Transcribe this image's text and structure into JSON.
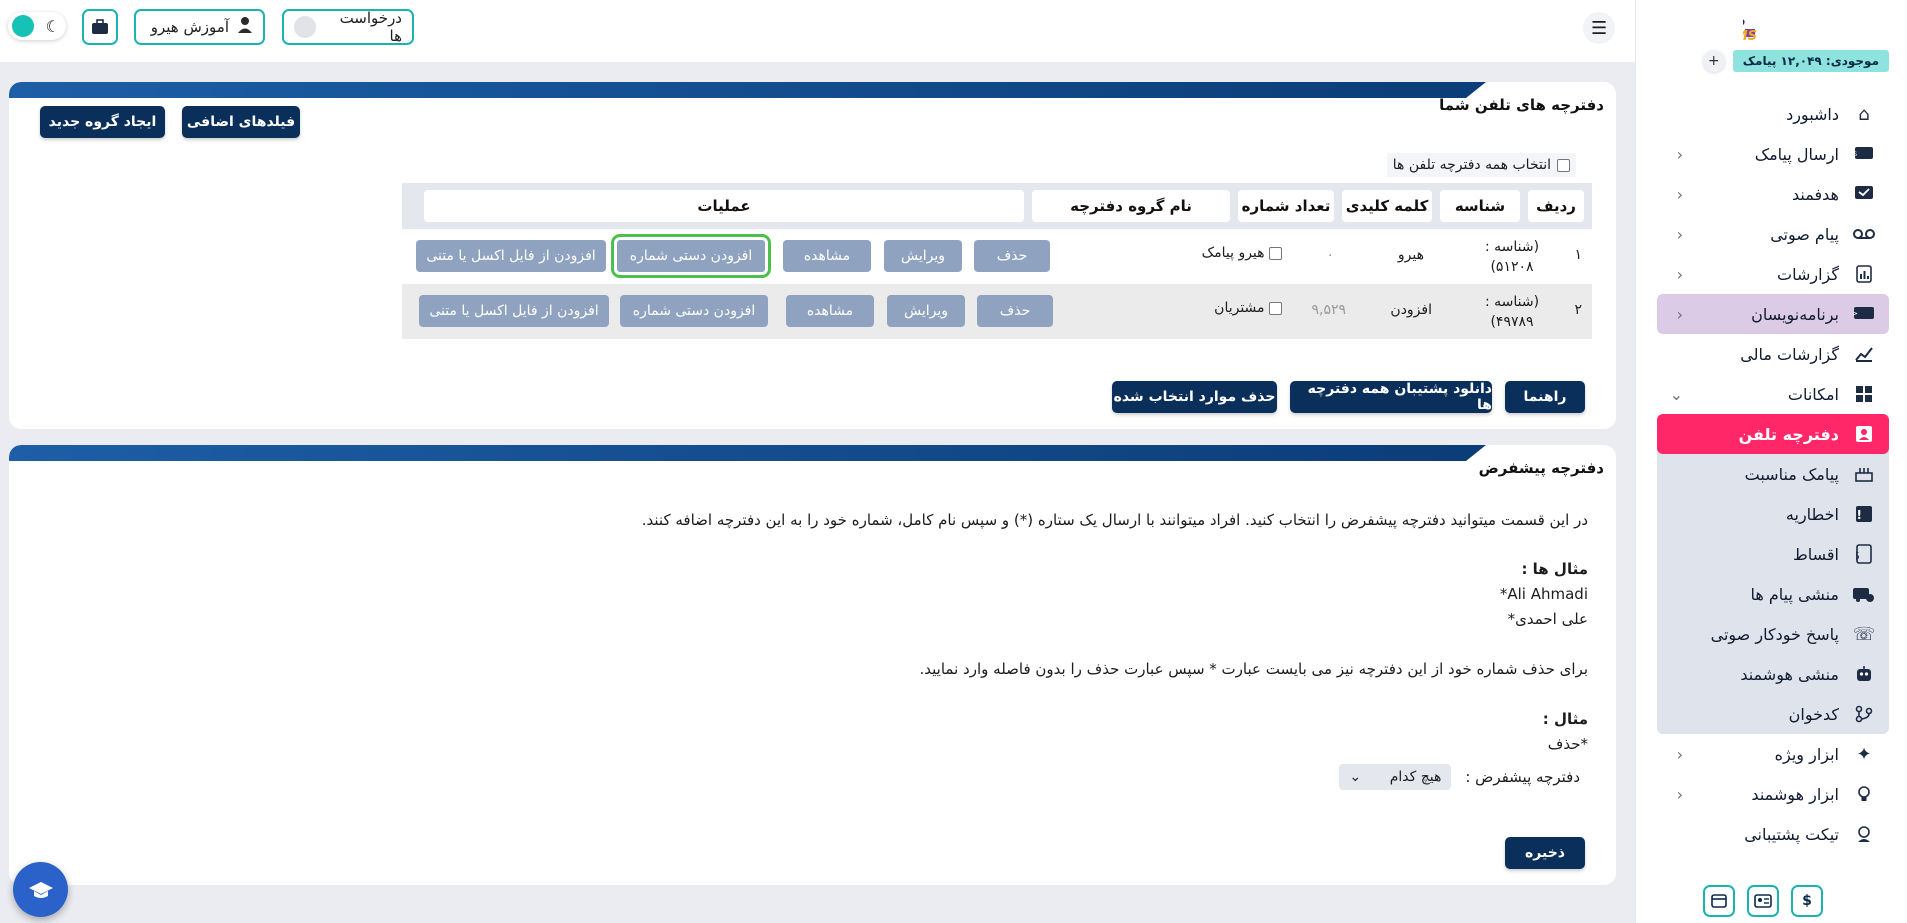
{
  "sidebar": {
    "credit": "موجودی: ۱۲,۰۴۹ پیامک",
    "add_credit": "+",
    "items": [
      {
        "label": "داشبورد",
        "icon": "home-icon"
      },
      {
        "label": "ارسال پیامک",
        "icon": "sms-icon"
      },
      {
        "label": "هدفمند",
        "icon": "target-message-icon"
      },
      {
        "label": "پیام صوتی",
        "icon": "voicemail-icon"
      },
      {
        "label": "گزارشات",
        "icon": "report-icon"
      },
      {
        "label": "برنامه‌نویسان",
        "icon": "developer-icon"
      },
      {
        "label": "گزارشات مالی",
        "icon": "finance-chart-icon"
      },
      {
        "label": "امکانات",
        "icon": "features-icon"
      }
    ],
    "sub_items": [
      {
        "label": "دفترچه تلفن",
        "icon": "contact-book-icon"
      },
      {
        "label": "پیامک مناسبت",
        "icon": "cake-icon"
      },
      {
        "label": "اخطاریه",
        "icon": "warning-icon"
      },
      {
        "label": "اقساط",
        "icon": "installment-icon"
      },
      {
        "label": "منشی پیام ها",
        "icon": "message-assistant-icon"
      },
      {
        "label": "پاسخ خودکار صوتی",
        "icon": "phone-auto-reply-icon"
      },
      {
        "label": "منشی هوشمند",
        "icon": "robot-icon"
      },
      {
        "label": "کدخوان",
        "icon": "code-reader-icon"
      }
    ],
    "more_items": [
      {
        "label": "ابزار ویژه",
        "icon": "sparkle-icon"
      },
      {
        "label": "ابزار هوشمند",
        "icon": "bulb-icon"
      },
      {
        "label": "تیکت پشتیبانی",
        "icon": "support-icon"
      }
    ]
  },
  "topbar": {
    "requests_label": "درخواست ها",
    "learn_label": "آموزش هیرو"
  },
  "phonebooks": {
    "title": "دفترچه های تلفن شما",
    "extra_fields": "فیلدهای اضافی",
    "new_group": "ایجاد گروه جدید",
    "select_all": "انتخاب همه دفترچه تلفن ها",
    "headers": [
      "ردیف",
      "شناسه",
      "کلمه کلیدی",
      "تعداد شماره",
      "نام گروه دفترچه",
      "عملیات"
    ],
    "rows": [
      {
        "num": "۱",
        "id_label": "(شناسه :",
        "id_value": "۵۱۲۰۸)",
        "keyword": "هیرو",
        "count": "۰",
        "name": "هیرو پیامک"
      },
      {
        "num": "۲",
        "id_label": "(شناسه :",
        "id_value": "۴۹۷۸۹)",
        "keyword": "افزودن",
        "count": "۹,۵۲۹",
        "name": "مشتریان"
      }
    ],
    "actions": {
      "delete": "حذف",
      "edit": "ویرایش",
      "view": "مشاهده",
      "add_manual": "افزودن دستی شماره",
      "add_file": "افزودن از فایل اکسل یا متنی"
    },
    "guide": "راهنما",
    "download_backup": "دانلود پشتیبان همه دفترچه ها",
    "delete_selected": "حذف موارد انتخاب شده"
  },
  "default_book": {
    "title": "دفترچه پیشفرض",
    "intro": "در این قسمت میتوانید دفترچه پیشفرض را انتخاب کنید. افراد میتوانند با ارسال یک ستاره (*) و سپس نام کامل، شماره خود را به این دفترچه اضافه کنند.",
    "examples_title": "مثال ها :",
    "example1": "*Ali Ahmadi",
    "example2": "علی احمدی*",
    "delete_note": "برای حذف شماره خود از این دفترچه نیز می بایست عبارت * سپس عبارت حذف را بدون فاصله وارد نمایید.",
    "example_title": "مثال :",
    "example_delete": "*حذف",
    "select_label": "دفترچه پیشفرض :",
    "select_value": "هیچ کدام",
    "save": "ذخیره"
  }
}
